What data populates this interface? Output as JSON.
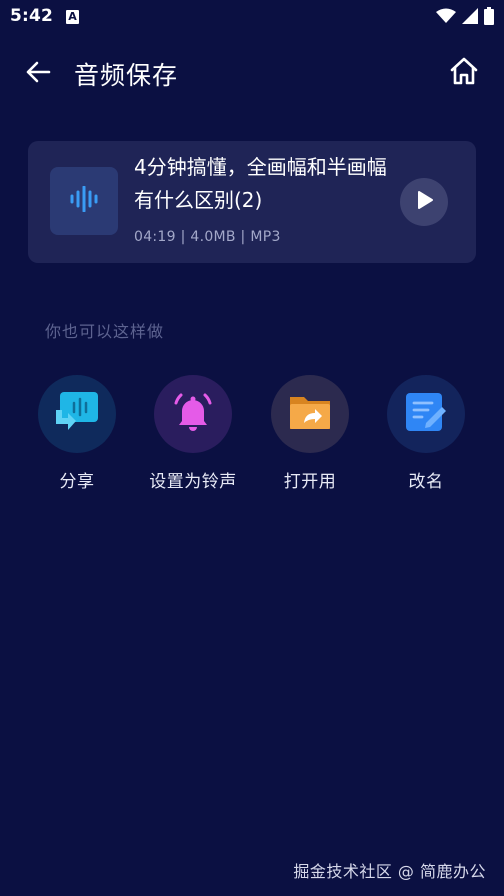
{
  "status_bar": {
    "time": "5:42",
    "notification_badge": "A",
    "icons": [
      "wifi-icon",
      "signal-icon",
      "battery-icon"
    ]
  },
  "header": {
    "title": "音频保存",
    "back_icon": "back-arrow-icon",
    "home_icon": "home-icon"
  },
  "audio_card": {
    "title": "4分钟搞懂，全画幅和半画幅有什么区别(2)",
    "meta": "04:19 | 4.0MB | MP3",
    "thumb_icon": "audio-waveform-icon",
    "play_icon": "play-icon"
  },
  "section_label": "你也可以这样做",
  "actions": [
    {
      "label": "分享",
      "icon": "share-icon",
      "color": "#1fb6e6"
    },
    {
      "label": "设置为铃声",
      "icon": "bell-icon",
      "color": "#e55be8"
    },
    {
      "label": "打开用",
      "icon": "folder-open-icon",
      "color": "#f0a23a"
    },
    {
      "label": "改名",
      "icon": "rename-icon",
      "color": "#3a8cf5"
    }
  ],
  "footer": "掘金技术社区 @ 简鹿办公",
  "colors": {
    "background": "#0b1042",
    "card": "#1f2456",
    "accent": "#3a8cf5"
  }
}
